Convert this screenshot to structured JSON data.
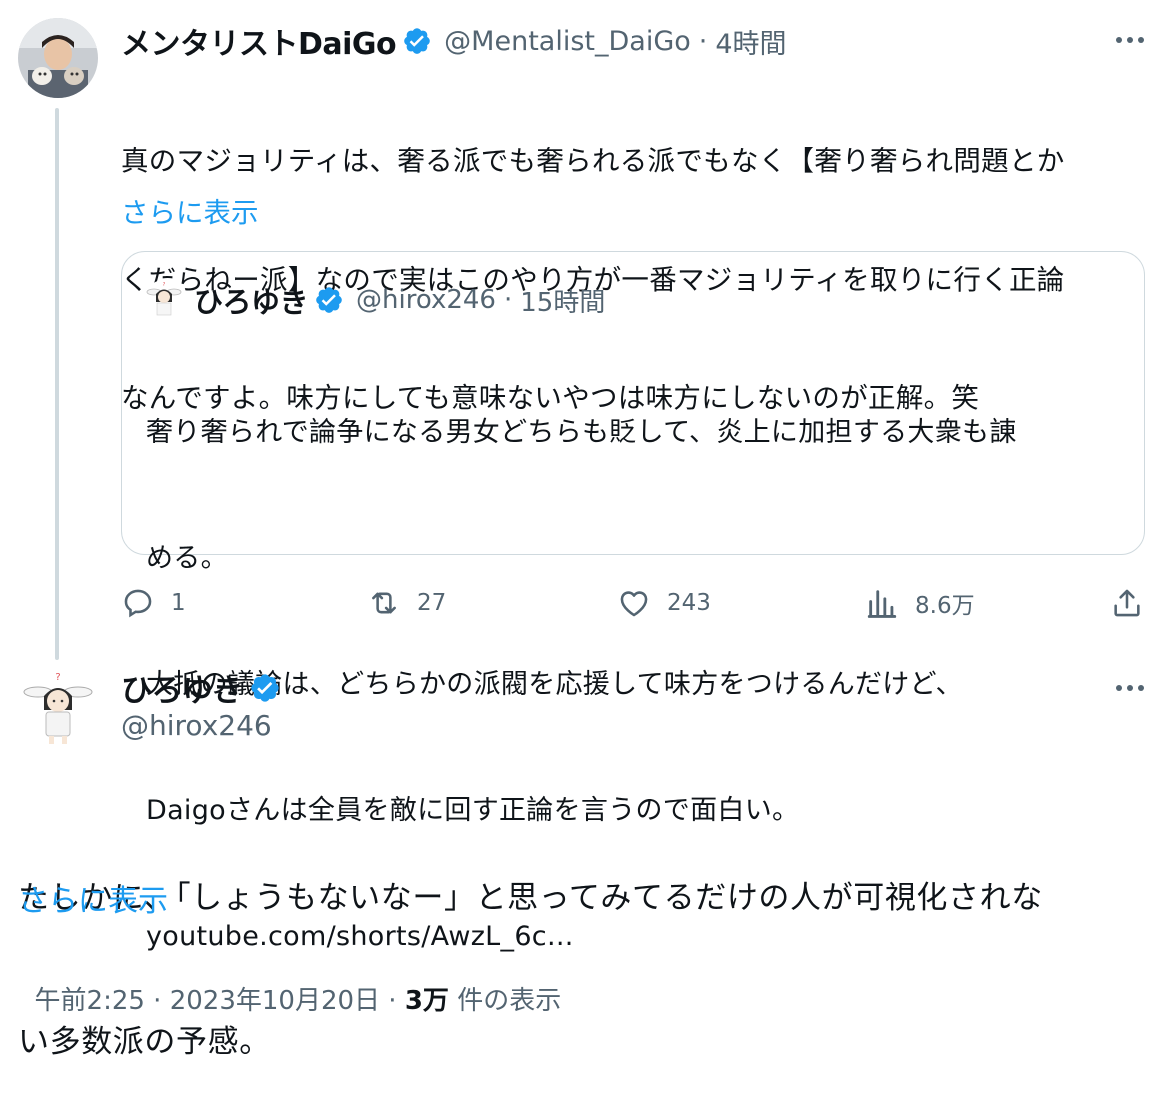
{
  "tweet1": {
    "display_name": "メンタリストDaiGo",
    "handle": "@Mentalist_DaiGo",
    "separator": "·",
    "time": "4時間",
    "text": "真のマジョリティは、奢る派でも奢られる派でもなく【奢り奢られ問題とかくだらねー派】なので実はこのやり方が一番マジョリティを取りに行く正論なんですよ。味方にしても意味ないやつは味方にしないのが正解。笑",
    "lines": [
      "真のマジョリティは、奢る派でも奢られる派でもなく【奢り奢られ問題とか",
      "くだらねー派】なので実はこのやり方が一番マジョリティを取りに行く正論",
      "なんですよ。味方にしても意味ないやつは味方にしないのが正解。笑"
    ],
    "show_more": "さらに表示",
    "more_icon": "more-dots-icon"
  },
  "quote": {
    "display_name": "ひろゆき",
    "handle": "@hirox246",
    "separator": "·",
    "time": "15時間",
    "lines": [
      "奢り奢られで論争になる男女どちらも貶して、炎上に加担する大衆も諌",
      "める。",
      "大抵の議論は、どちらかの派閥を応援して味方をつけるんだけど、",
      "Daigoさんは全員を敵に回す正論を言うので面白い。",
      "youtube.com/shorts/AwzL_6c..."
    ]
  },
  "actions": {
    "reply": {
      "icon": "reply-icon",
      "count": "1"
    },
    "retweet": {
      "icon": "retweet-icon",
      "count": "27"
    },
    "like": {
      "icon": "heart-icon",
      "count": "243"
    },
    "views": {
      "icon": "analytics-icon",
      "count": "8.6万"
    },
    "share": {
      "icon": "share-icon"
    }
  },
  "tweet2": {
    "display_name": "ひろゆき",
    "handle": "@hirox246",
    "lines": [
      "たしかに、「しょうもないなー」と思ってみてるだけの人が可視化されな",
      "い多数派の予感。"
    ],
    "show_more": "さらに表示",
    "timestamp": "午前2:25 · 2023年10月20日 · ",
    "views_count": "3万",
    "views_label": " 件の表示"
  },
  "colors": {
    "accent": "#1d9bf0",
    "text": "#0f1419",
    "secondary": "#536471",
    "border": "#cfd9de"
  }
}
